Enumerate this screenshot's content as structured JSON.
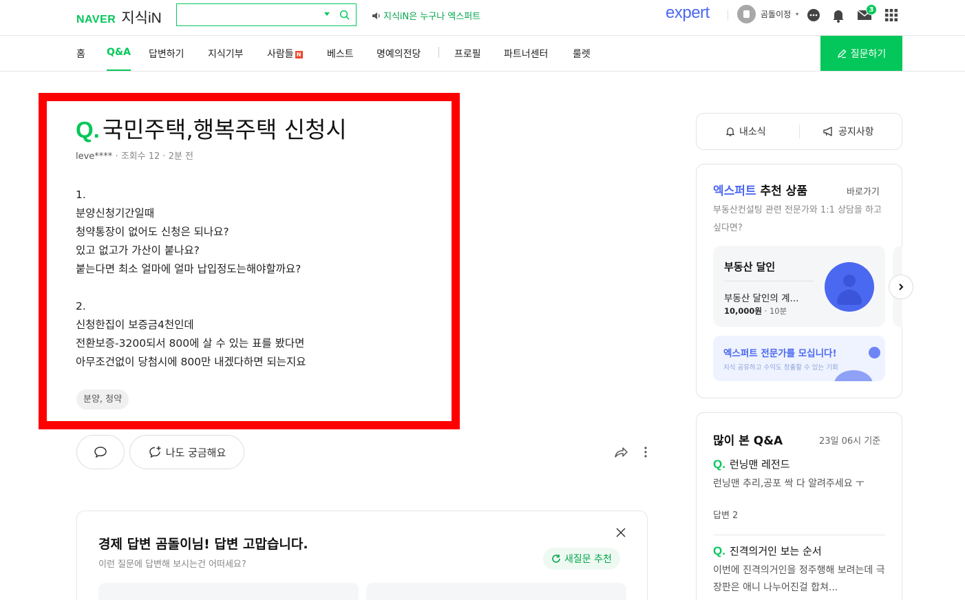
{
  "header": {
    "logo_naver": "NAVER",
    "logo_kin": "지식iN",
    "search_placeholder": "",
    "notice": "지식iN은 누구나 엑스퍼트",
    "expert_logo": "expert",
    "username": "곰돌이정",
    "mail_count": "3"
  },
  "nav": {
    "items": [
      "홈",
      "Q&A",
      "답변하기",
      "지식기부",
      "사람들",
      "베스트",
      "명예의전당",
      "프로필",
      "파트너센터",
      "룰렛"
    ],
    "people_badge": "N",
    "ask_button": "질문하기"
  },
  "question": {
    "q_mark": "Q.",
    "title": "국민주택,행복주택 신청시",
    "author": "leve****",
    "views": "조회수 12",
    "time": "2분 전",
    "body": "1.\n분양신청기간일때\n청약통장이 없어도 신청은 되나요?\n있고 없고가 가산이 붙나요?\n붙는다면 최소 얼마에 얼마 납입정도는해야할까요?\n\n2.\n신청한집이 보증금4천인데\n전환보증-3200되서 800에 살 수 있는 표를 봤다면\n아무조건없이 당첨시에 800만 내겠다하면 되는지요",
    "tag": "분양, 청약",
    "curious_button": "나도 궁금해요"
  },
  "answer_card": {
    "title": "경제 답변 곰돌이님! 답변 고맙습니다.",
    "subtitle": "이런 질문에 답변해 보시는건 어떠세요?",
    "new_question": "새질문 추천"
  },
  "sidebar": {
    "news": "내소식",
    "notice": "공지사항",
    "expert": {
      "title_blue": "엑스퍼트",
      "title_rest": " 추천 상품",
      "link": "바로가기",
      "desc": "부동산컨설팅 관련 전문가와 1:1 상담을 하고 싶다면?",
      "card_title": "부동산 달인",
      "card_name": "부동산 달인의 계...",
      "card_price": "10,000원",
      "card_duration": "10분",
      "recruit_title": "엑스퍼트 전문가를 모십니다!",
      "recruit_sub": "지식 공유하고 수익도 창출할 수 있는 기회"
    },
    "popular": {
      "title": "많이 본 Q&A",
      "date": "23일 06시 기준",
      "q_mark": "Q.",
      "items": [
        {
          "q": "런닝맨 레전드",
          "desc": "런닝맨 추리,공포 싹 다 알려주세요 ㅜ",
          "answers": "답변 2"
        },
        {
          "q": "진격의거인 보는 순서",
          "desc": "이번에 진격의거인을 정주행해 보려는데 극장판은 애니 나누어진걸 합쳐..."
        }
      ]
    }
  }
}
